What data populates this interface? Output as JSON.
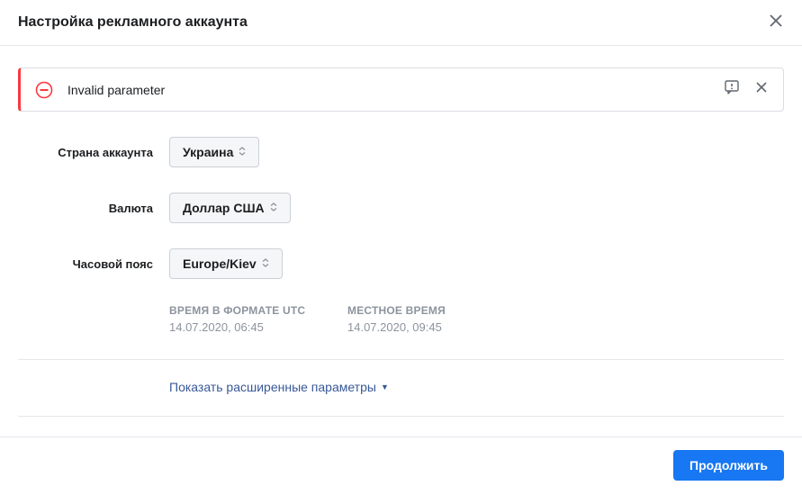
{
  "header": {
    "title": "Настройка рекламного аккаунта"
  },
  "alert": {
    "message": "Invalid parameter"
  },
  "form": {
    "country": {
      "label": "Страна аккаунта",
      "value": "Украина"
    },
    "currency": {
      "label": "Валюта",
      "value": "Доллар США"
    },
    "timezone": {
      "label": "Часовой пояс",
      "value": "Europe/Kiev"
    }
  },
  "time_info": {
    "utc": {
      "label": "ВРЕМЯ В ФОРМАТЕ UTC",
      "value": "14.07.2020, 06:45"
    },
    "local": {
      "label": "МЕСТНОЕ ВРЕМЯ",
      "value": "14.07.2020, 09:45"
    }
  },
  "advanced_link": "Показать расширенные параметры",
  "footer": {
    "continue": "Продолжить"
  }
}
